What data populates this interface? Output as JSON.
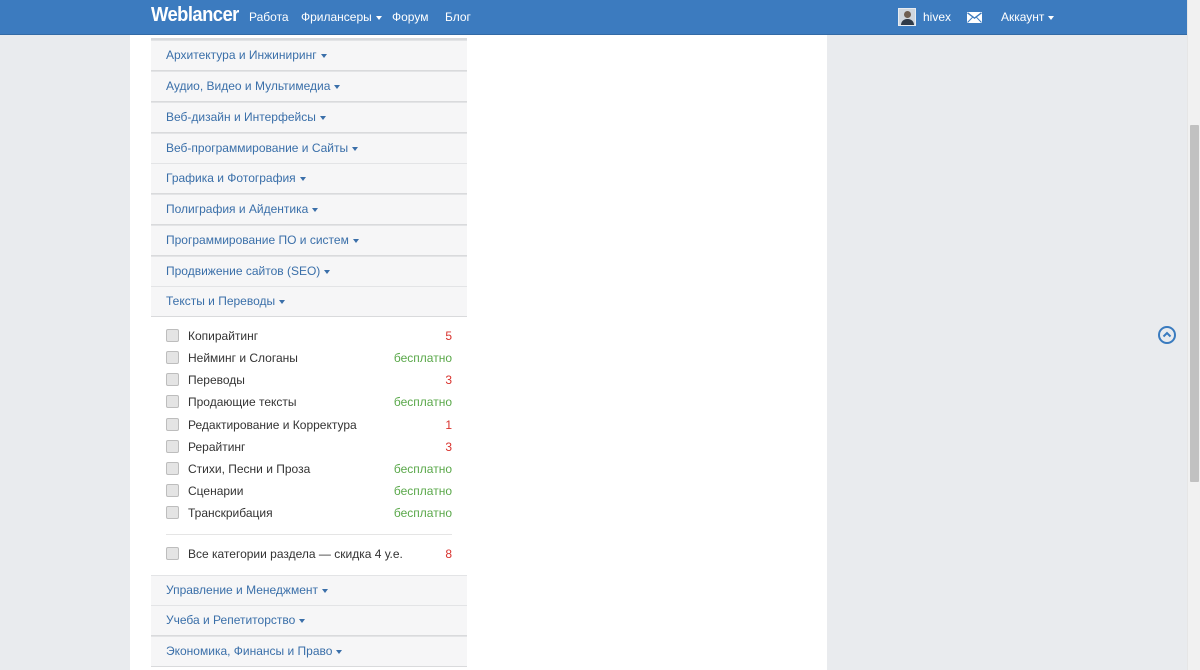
{
  "nav": {
    "brand": "Weblancer",
    "links": [
      "Работа",
      "Фрилансеры",
      "Форум",
      "Блог"
    ],
    "username": "hivex",
    "account": "Аккаунт"
  },
  "categories_top": [
    "Архитектура и Инжиниринг",
    "Аудио, Видео и Мультимедиа",
    "Веб-дизайн и Интерфейсы",
    "Веб-программирование и Сайты",
    "Графика и Фотография",
    "Полиграфия и Айдентика",
    "Программирование ПО и систем",
    "Продвижение сайтов (SEO)",
    "Тексты и Переводы"
  ],
  "subcategories": [
    {
      "label": "Копирайтинг",
      "price": "5",
      "color": "#d8322d"
    },
    {
      "label": "Нейминг и Слоганы",
      "price": "бесплатно",
      "color": "#5aa84a"
    },
    {
      "label": "Переводы",
      "price": "3",
      "color": "#d8322d"
    },
    {
      "label": "Продающие тексты",
      "price": "бесплатно",
      "color": "#5aa84a"
    },
    {
      "label": "Редактирование и Корректура",
      "price": "1",
      "color": "#d8322d"
    },
    {
      "label": "Рерайтинг",
      "price": "3",
      "color": "#d8322d"
    },
    {
      "label": "Стихи, Песни и Проза",
      "price": "бесплатно",
      "color": "#5aa84a"
    },
    {
      "label": "Сценарии",
      "price": "бесплатно",
      "color": "#5aa84a"
    },
    {
      "label": "Транскрибация",
      "price": "бесплатно",
      "color": "#5aa84a"
    }
  ],
  "all_categories": {
    "label": "Все категории раздела — скидка 4 у.е.",
    "price": "8",
    "color": "#d8322d"
  },
  "categories_bottom": [
    "Управление и Менеджмент",
    "Учеба и Репетиторство",
    "Экономика, Финансы и Право"
  ],
  "colors": {
    "navbar": "#3c7bbf",
    "link": "#3a6fa9",
    "price_paid": "#d8322d",
    "price_free": "#5aa84a"
  }
}
